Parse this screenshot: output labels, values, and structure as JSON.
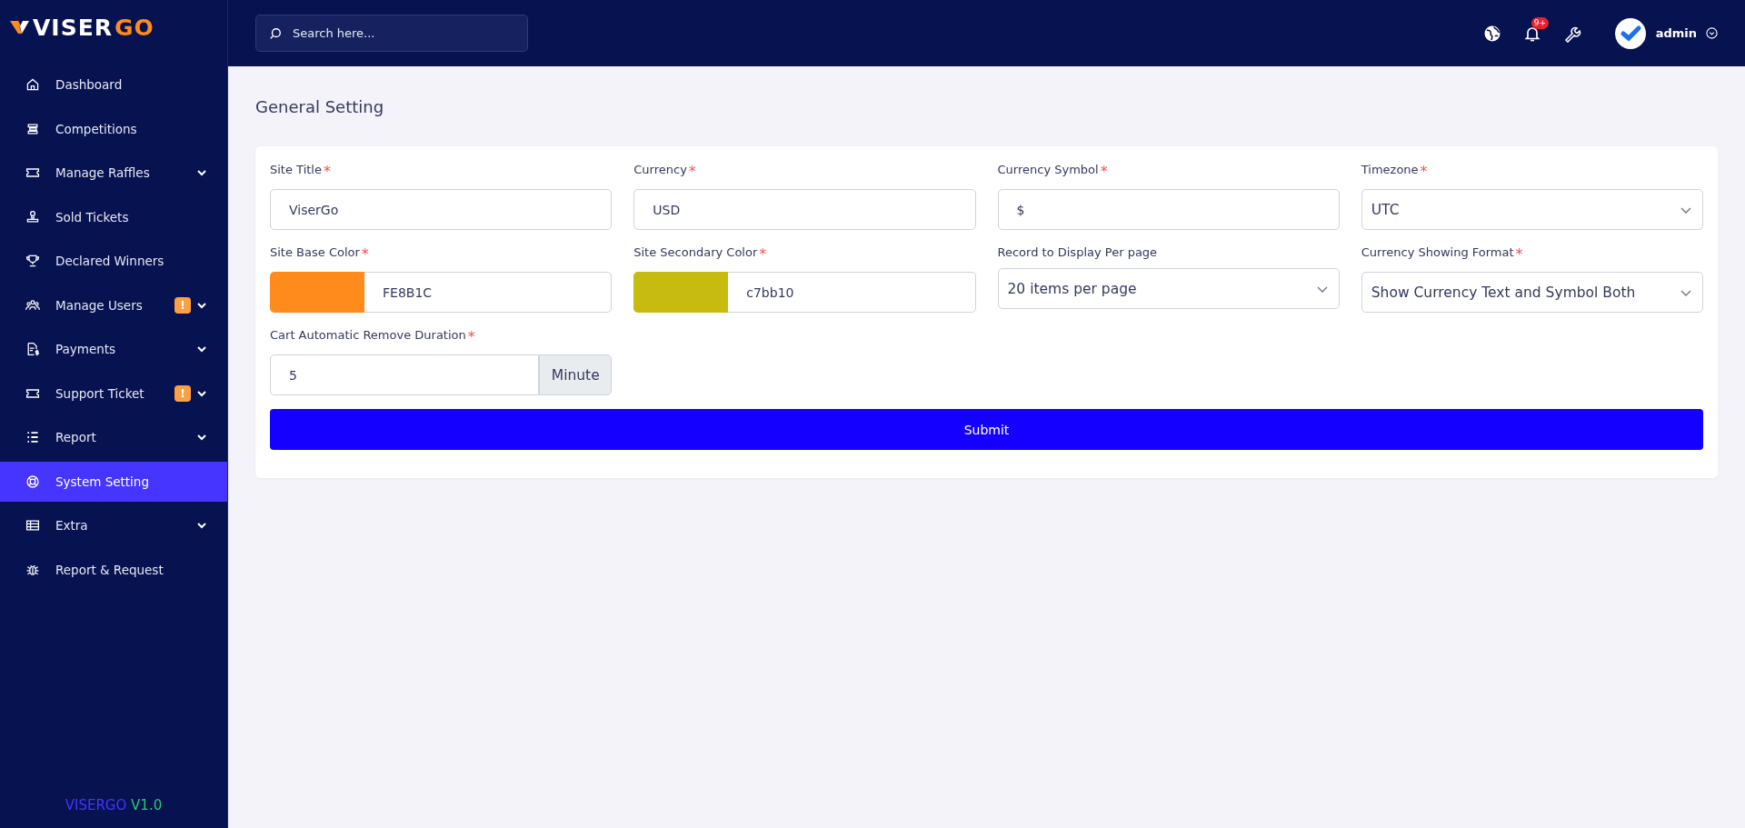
{
  "logo": {
    "text": "VISER",
    "accent": "GO"
  },
  "sidebar": {
    "items": [
      {
        "label": "Dashboard",
        "selected": false,
        "submenu": false
      },
      {
        "label": "Competitions",
        "selected": false,
        "submenu": false
      },
      {
        "label": "Manage Raffles",
        "selected": false,
        "submenu": true
      },
      {
        "label": "Sold Tickets",
        "selected": false,
        "submenu": false
      },
      {
        "label": "Declared Winners",
        "selected": false,
        "submenu": false
      },
      {
        "label": "Manage Users",
        "selected": false,
        "submenu": true,
        "badge": "!"
      },
      {
        "label": "Payments",
        "selected": false,
        "submenu": true
      },
      {
        "label": "Support Ticket",
        "selected": false,
        "submenu": true,
        "badge": "!"
      },
      {
        "label": "Report",
        "selected": false,
        "submenu": true
      },
      {
        "label": "System Setting",
        "selected": true,
        "submenu": false
      },
      {
        "label": "Extra",
        "selected": false,
        "submenu": true
      },
      {
        "label": "Report & Request",
        "selected": false,
        "submenu": false
      }
    ],
    "footer": {
      "name": "VISERGO",
      "version": "V1.0"
    }
  },
  "header": {
    "search": {
      "placeholder": "Search here..."
    },
    "notification_badge": "9+",
    "user": "admin"
  },
  "page_title": "General Setting",
  "form": {
    "fields": [
      {
        "kind": "text",
        "label": "Site Title",
        "required_mark": "*",
        "value": "ViserGo"
      },
      {
        "kind": "text",
        "label": "Currency",
        "required_mark": "*",
        "value": "USD"
      },
      {
        "kind": "text",
        "label": "Currency Symbol",
        "required_mark": "*",
        "value": "$"
      },
      {
        "kind": "select",
        "label": "Timezone",
        "required_mark": "*",
        "value": "UTC"
      },
      {
        "kind": "color",
        "label": "Site Base Color",
        "required_mark": "*",
        "value": "FE8B1C",
        "color": "#fe8b1c"
      },
      {
        "kind": "color",
        "label": "Site Secondary Color",
        "required_mark": "*",
        "value": "c7bb10",
        "color": "#c7bb10"
      },
      {
        "kind": "select",
        "label": "Record to Display Per page",
        "value": "20 items per page"
      },
      {
        "kind": "select",
        "label": "Currency Showing Format",
        "required_mark": "*",
        "value": "Show Currency Text and Symbol Both"
      },
      {
        "kind": "addon",
        "label": "Cart Automatic Remove Duration",
        "required_mark": "*",
        "value": "5",
        "addon": "Minute"
      }
    ],
    "submit": "Submit"
  }
}
